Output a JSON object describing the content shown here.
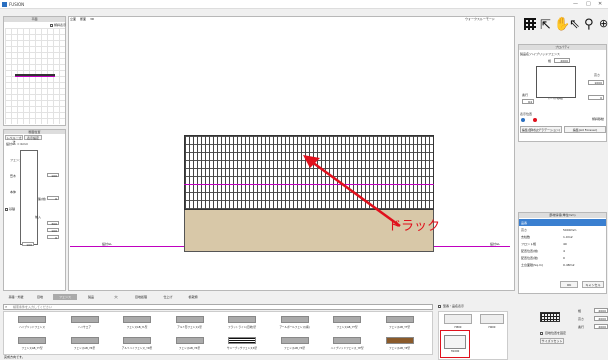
{
  "window": {
    "title": "FUSION",
    "controls": [
      "—",
      "□",
      "✕"
    ]
  },
  "menu": [
    "断面",
    "編集(E)",
    "配置図面(N)"
  ],
  "left_top": {
    "title": "平面",
    "checkbox_label": "傾斜表示"
  },
  "left_bottom": {
    "header": "断面位置",
    "tabs": [
      "レベル・寸法",
      "表示設定"
    ],
    "gl_label": "設計GL = 0mm",
    "labels": [
      "フェンス",
      "笠木",
      "本体",
      "基礎",
      "基準線",
      "目地",
      "地盤(前)",
      "前入"
    ],
    "values": [
      "600",
      "100",
      "0",
      "300",
      "100",
      "0",
      "0",
      "100"
    ]
  },
  "canvas": {
    "header_tabs": [
      "立面",
      "断面",
      "3D"
    ],
    "top_right": "ウォークスルーモード",
    "left_label": "設計GL",
    "right_label": "設計GL",
    "annotation": "ドラック"
  },
  "toolbar_icons": [
    "grid-icon",
    "arrow-cursor-icon",
    "hand-icon",
    "pointer-icon",
    "pin-icon",
    "zoom-icon"
  ],
  "right_top": {
    "header": "プロパティ",
    "name_label": "製品名：",
    "name_value": "ハイブリッドフェンス",
    "rows": [
      {
        "label": "幅",
        "value": "2000"
      },
      {
        "label": "高さ",
        "value": "1000"
      },
      {
        "label": "奥行",
        "value": "64"
      },
      {
        "label": "レベル移動",
        "value": "0"
      }
    ],
    "radio_label": "表示位置",
    "checkbox_label": "傾斜移動",
    "buttons": [
      "編集(部材はグラデーション)",
      "編集(Ad Forever)"
    ]
  },
  "right_props": {
    "header": "部材情報(単位mm)",
    "rows": [
      {
        "label": "品番",
        "value": ""
      },
      {
        "label": "高さ",
        "value": "5000mm"
      },
      {
        "label": "支柱数",
        "value": "1.0m2"
      },
      {
        "label": "フロント幅",
        "value": "40"
      },
      {
        "label": "配置位置(前)",
        "value": "4"
      },
      {
        "label": "配置位置(後)",
        "value": "0"
      },
      {
        "label": "土台面積(Sq.m)",
        "value": "0.48m2"
      }
    ],
    "ok": "OK",
    "cancel": "キャンセル"
  },
  "categories": [
    "基礎・外壁",
    "目地",
    "フェンス",
    "製品",
    "穴",
    "目地処理",
    "仕上げ",
    "植栽類"
  ],
  "search": {
    "placeholder": "検索条件を入力してください",
    "checkbox_label": "型番・品名表示"
  },
  "items": [
    [
      "ハイブリッドフェンス",
      "ハイサエア",
      "フェンスAB_YL型",
      "アルミ形フェンスL型",
      "フラットライン(目地)型",
      "アールボールフェンス(横)",
      "フェンスAB_YT型",
      "フェンスAB_YT型"
    ],
    [
      "フェンスAB_YY型",
      "フェンスAB_YR型",
      "アルミハイフェンス_YR型",
      "フェンスAB_YR型",
      "サニーブックフェンスS型",
      "フェンスAB_YS型",
      "ハイブリッドフェンス_YP型",
      "フェンスAB_YP型"
    ]
  ],
  "right_items": [
    {
      "label": "H800"
    },
    {
      "label": "H600"
    },
    {
      "label": "H1000"
    }
  ],
  "right_bottom": {
    "rows": [
      {
        "label": "幅",
        "value": "2000"
      },
      {
        "label": "高さ",
        "value": "2000"
      },
      {
        "label": "奥行",
        "value": "2000"
      }
    ],
    "checkbox_label": "目地位置を固定",
    "button": "サイズリセット"
  },
  "status": "完成方向です。",
  "colors": {
    "accent_red": "#e0101c",
    "magenta_line": "#c000c0",
    "wall_tan": "#d8c8a8",
    "select_blue": "#2a6fc0"
  }
}
